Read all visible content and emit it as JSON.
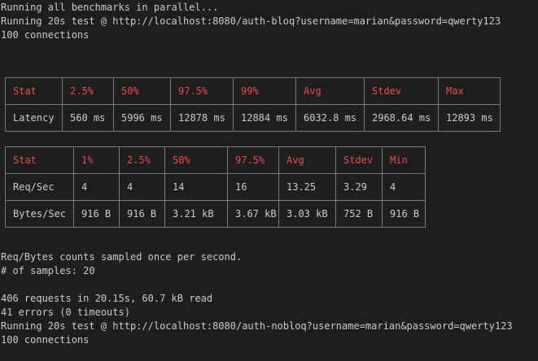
{
  "terminal": {
    "lines_top": [
      "Running all benchmarks in parallel...",
      "Running 20s test @ http://localhost:8080/auth-bloq?username=marian&password=qwerty123",
      "100 connections"
    ],
    "latency_table": {
      "header": [
        "Stat",
        "2.5%",
        "50%",
        "97.5%",
        "99%",
        "Avg",
        "Stdev",
        "Max"
      ],
      "rows": [
        [
          "Latency",
          "560 ms",
          "5996 ms",
          "12878 ms",
          "12884 ms",
          "6032.8 ms",
          "2968.64 ms",
          "12893 ms"
        ]
      ]
    },
    "throughput_table": {
      "header": [
        "Stat",
        "1%",
        "2.5%",
        "50%",
        "97.5%",
        "Avg",
        "Stdev",
        "Min"
      ],
      "rows": [
        [
          "Req/Sec",
          "4",
          "4",
          "14",
          "16",
          "13.25",
          "3.29",
          "4"
        ],
        [
          "Bytes/Sec",
          "916 B",
          "916 B",
          "3.21 kB",
          "3.67 kB",
          "3.03 kB",
          "752 B",
          "916 B"
        ]
      ]
    },
    "lines_bottom": [
      "Req/Bytes counts sampled once per second.",
      "# of samples: 20",
      "",
      "406 requests in 20.15s, 60.7 kB read",
      "41 errors (0 timeouts)",
      "Running 20s test @ http://localhost:8080/auth-nobloq?username=marian&password=qwerty123",
      "100 connections"
    ],
    "colors": {
      "background": "#1e1e1e",
      "text": "#cccccc",
      "header_text": "#f14c4c",
      "table_border": "#7a7a7a"
    }
  }
}
